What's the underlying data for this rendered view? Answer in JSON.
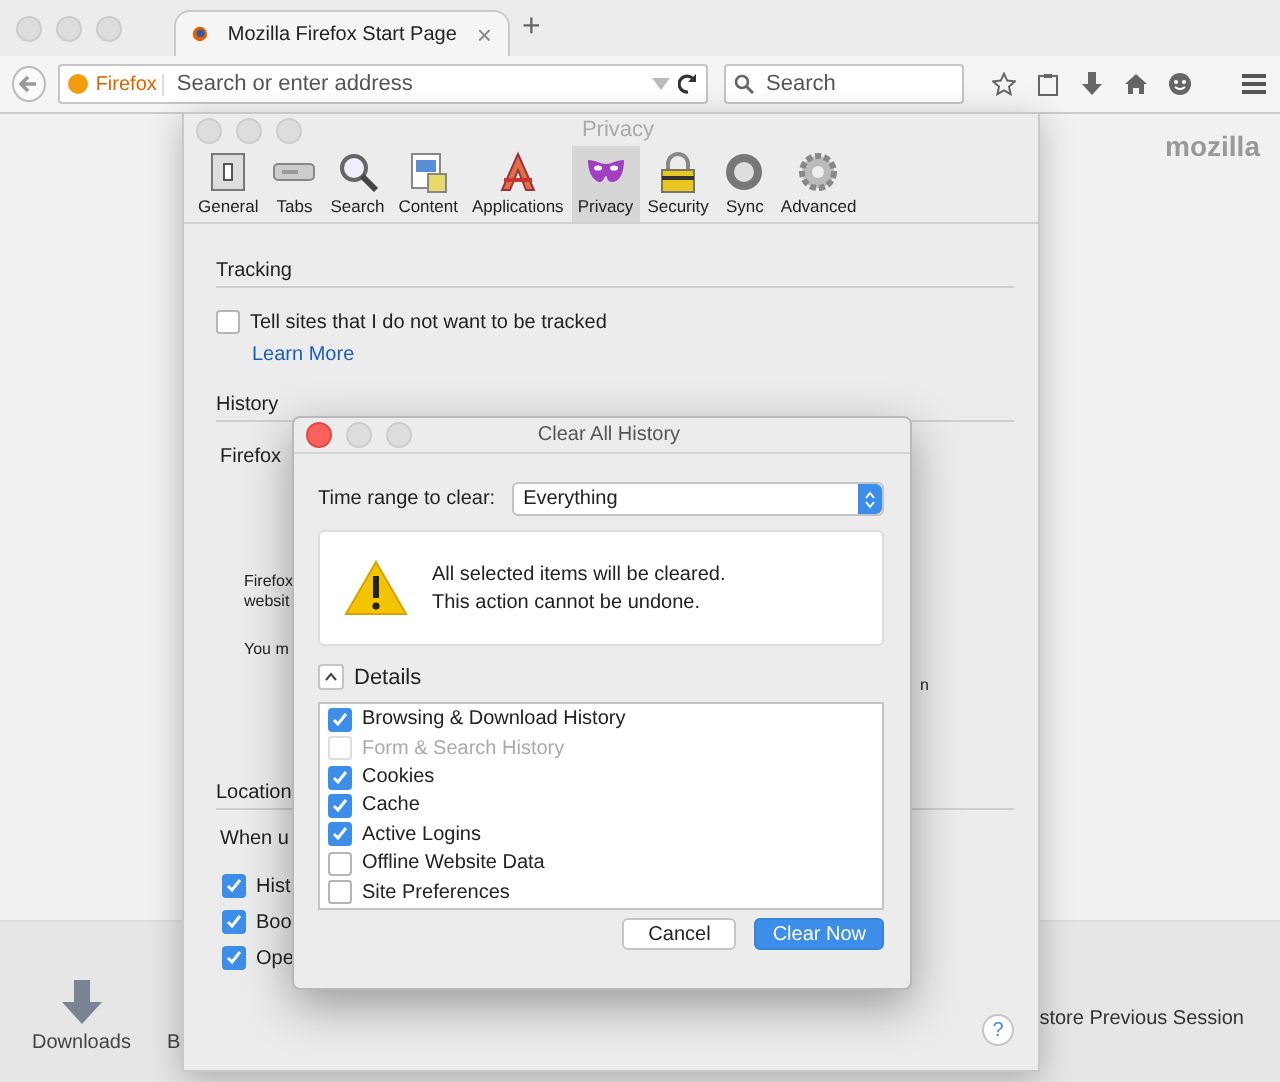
{
  "browser": {
    "tab": {
      "title": "Mozilla Firefox Start Page",
      "close": "×"
    },
    "new_tab": "+",
    "address": {
      "badge": "Firefox",
      "placeholder": "Search or enter address"
    },
    "search": {
      "placeholder": "Search"
    },
    "page": {
      "logo": "mozilla",
      "launchers": [
        {
          "label": "Downloads"
        },
        {
          "label": "B"
        }
      ],
      "restore": "store Previous Session"
    }
  },
  "preferences": {
    "title": "Privacy",
    "panes": [
      {
        "label": "General",
        "selected": false
      },
      {
        "label": "Tabs",
        "selected": false
      },
      {
        "label": "Search",
        "selected": false
      },
      {
        "label": "Content",
        "selected": false
      },
      {
        "label": "Applications",
        "selected": false
      },
      {
        "label": "Privacy",
        "selected": true
      },
      {
        "label": "Security",
        "selected": false
      },
      {
        "label": "Sync",
        "selected": false
      },
      {
        "label": "Advanced",
        "selected": false
      }
    ],
    "tracking": {
      "heading": "Tracking",
      "option": {
        "label": "Tell sites that I do not want to be tracked",
        "checked": false
      },
      "link": "Learn More"
    },
    "history": {
      "heading": "History",
      "lead": "Firefox",
      "lines": [
        "Firefox",
        "websit"
      ],
      "note": "You m",
      "tail": "n"
    },
    "location": {
      "heading": "Location",
      "lead": "When u",
      "options": [
        {
          "label": "Hist",
          "checked": true
        },
        {
          "label": "Boo",
          "checked": true
        },
        {
          "label": "Ope",
          "checked": true
        }
      ]
    },
    "help": "?"
  },
  "dialog": {
    "title": "Clear All History",
    "range_label": "Time range to clear:",
    "range_value": "Everything",
    "warning": [
      "All selected items will be cleared.",
      "This action cannot be undone."
    ],
    "details": {
      "label": "Details",
      "expanded": true
    },
    "items": [
      {
        "label": "Browsing & Download History",
        "checked": true,
        "disabled": false
      },
      {
        "label": "Form & Search History",
        "checked": false,
        "disabled": true
      },
      {
        "label": "Cookies",
        "checked": true,
        "disabled": false
      },
      {
        "label": "Cache",
        "checked": true,
        "disabled": false
      },
      {
        "label": "Active Logins",
        "checked": true,
        "disabled": false
      },
      {
        "label": "Offline Website Data",
        "checked": false,
        "disabled": false
      },
      {
        "label": "Site Preferences",
        "checked": false,
        "disabled": false
      }
    ],
    "buttons": [
      {
        "label": "Cancel",
        "default": false
      },
      {
        "label": "Clear Now",
        "default": true
      }
    ]
  }
}
